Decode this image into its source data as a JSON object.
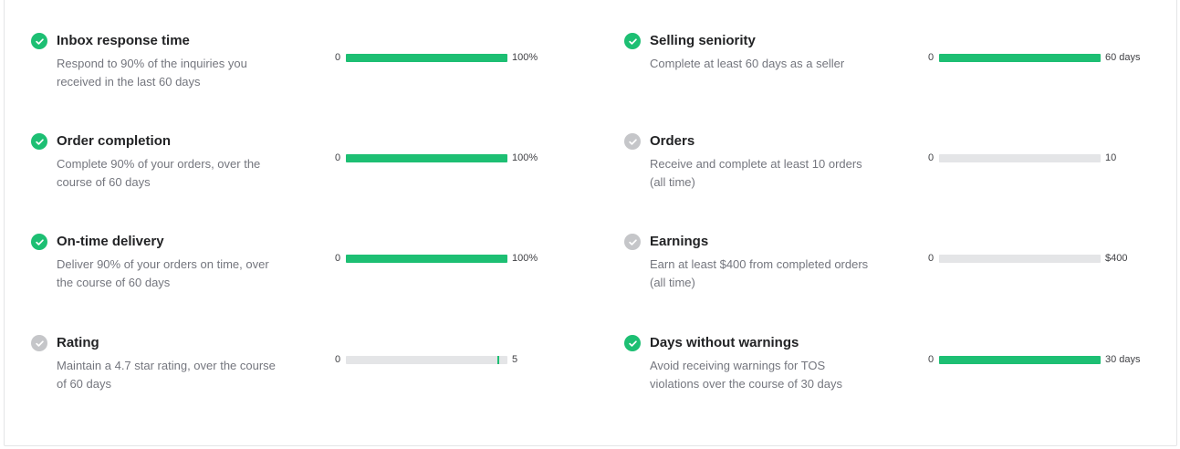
{
  "colors": {
    "accent": "#1dbf73",
    "pending": "#c5c6c9",
    "track": "#e4e5e7"
  },
  "requirements": [
    {
      "title": "Inbox response time",
      "description": "Respond to 90% of the inquiries you received in the last 60 days",
      "status": "done",
      "min_label": "0",
      "max_label": "100%",
      "progress": 1.0
    },
    {
      "title": "Selling seniority",
      "description": "Complete at least 60 days as a seller",
      "status": "done",
      "min_label": "0",
      "max_label": "60 days",
      "progress": 1.0
    },
    {
      "title": "Order completion",
      "description": "Complete 90% of your orders, over the course of 60 days",
      "status": "done",
      "min_label": "0",
      "max_label": "100%",
      "progress": 1.0
    },
    {
      "title": "Orders",
      "description": "Receive and complete at least 10 orders (all time)",
      "status": "pending",
      "min_label": "0",
      "max_label": "10",
      "progress": 0.0
    },
    {
      "title": "On-time delivery",
      "description": "Deliver 90% of your orders on time, over the course of 60 days",
      "status": "done",
      "min_label": "0",
      "max_label": "100%",
      "progress": 1.0
    },
    {
      "title": "Earnings",
      "description": "Earn at least $400 from completed orders (all time)",
      "status": "pending",
      "min_label": "0",
      "max_label": "$400",
      "progress": 0.0
    },
    {
      "title": "Rating",
      "description": "Maintain a 4.7 star rating, over the course of 60 days",
      "status": "pending",
      "min_label": "0",
      "max_label": "5",
      "progress": 0.0,
      "threshold": 0.94
    },
    {
      "title": "Days without warnings",
      "description": "Avoid receiving warnings for TOS violations over the course of 30 days",
      "status": "done",
      "min_label": "0",
      "max_label": "30 days",
      "progress": 1.0
    }
  ]
}
